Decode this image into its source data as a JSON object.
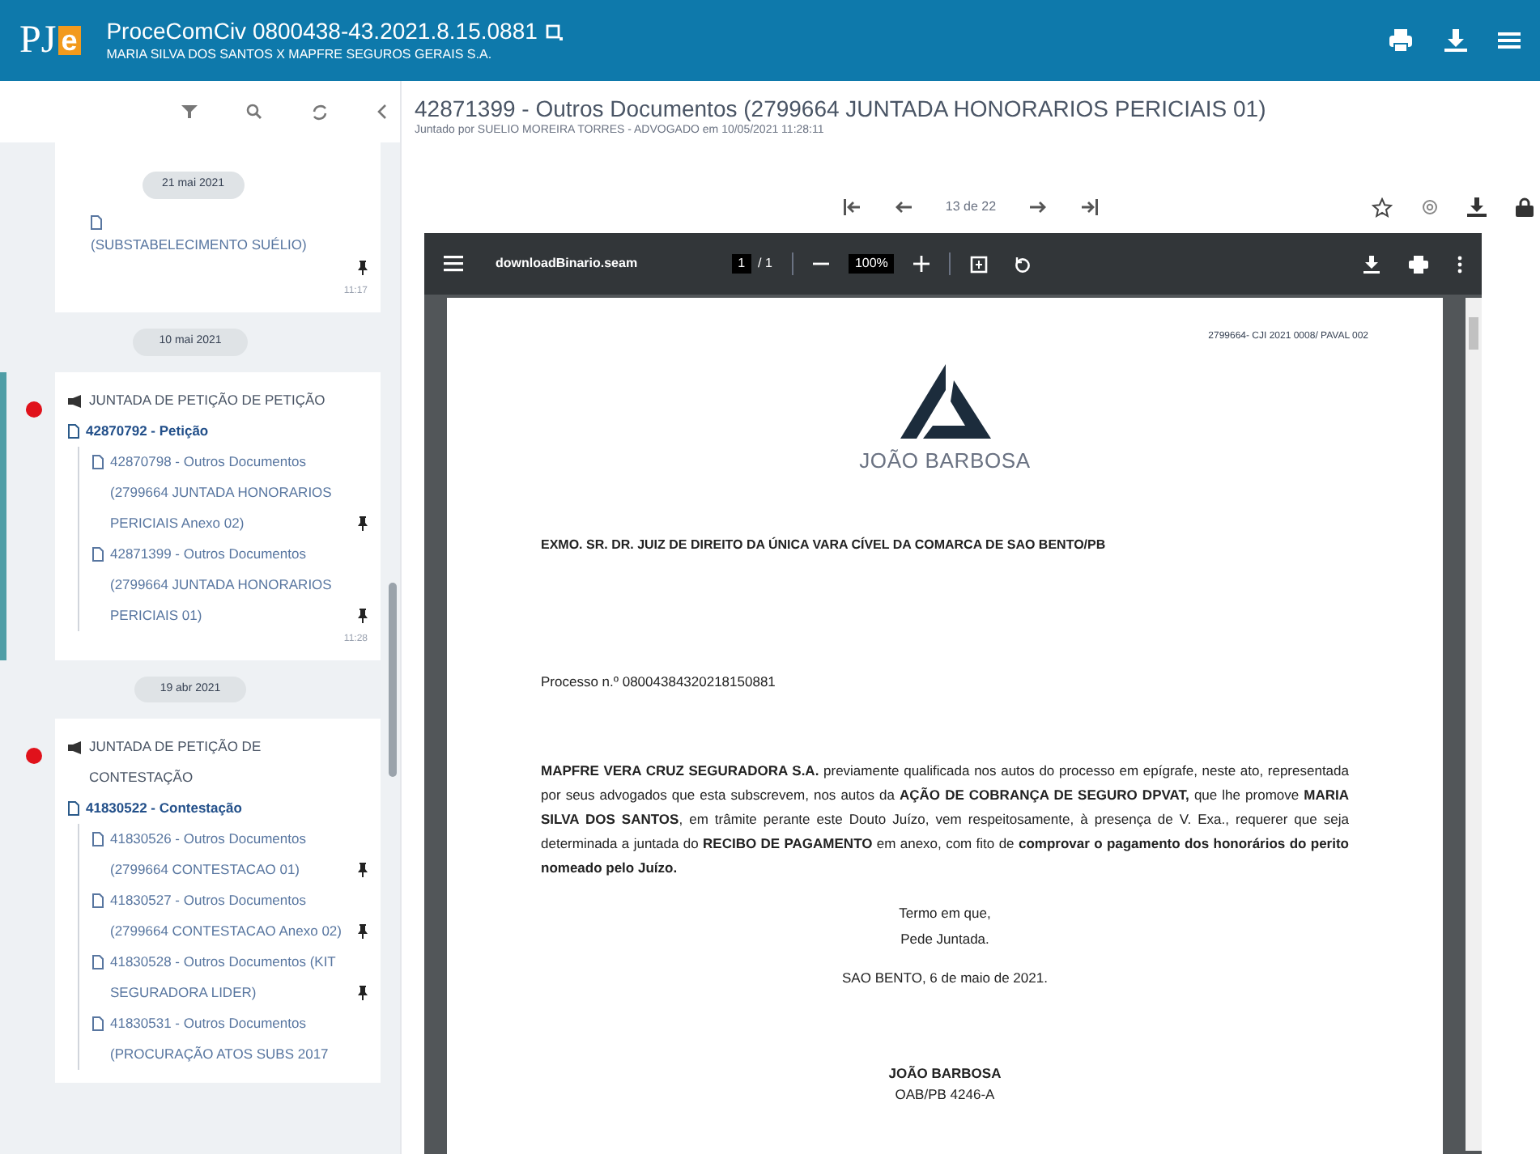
{
  "header": {
    "logo": {
      "left": "PJ",
      "right": "e"
    },
    "title": "ProceComCiv 0800438-43.2021.8.15.0881",
    "subtitle": "MARIA SILVA DOS SANTOS X MAPFRE SEGUROS GERAIS S.A."
  },
  "sidebar": {
    "sticky_date": "21 mai 2021",
    "events": [
      {
        "marked": false,
        "selected": false,
        "docs": [
          {
            "text": "(SUBSTABELECIMENTO SUÉLIO)",
            "pinned": true
          }
        ],
        "time": "11:17"
      },
      {
        "date": "10 mai 2021",
        "marked": true,
        "selected": true,
        "title": "JUNTADA DE PETIÇÃO DE PETIÇÃO",
        "main_doc": "42870792 - Petição",
        "docs": [
          {
            "text": "42870798 - Outros Documentos (2799664 JUNTADA HONORARIOS PERICIAIS Anexo 02)",
            "pinned": true
          },
          {
            "text": "42871399 - Outros Documentos (2799664 JUNTADA HONORARIOS PERICIAIS 01)",
            "pinned": true
          }
        ],
        "time": "11:28"
      },
      {
        "date": "19 abr 2021",
        "marked": true,
        "selected": false,
        "title": "JUNTADA DE PETIÇÃO DE CONTESTAÇÃO",
        "main_doc": "41830522 - Contestação",
        "docs": [
          {
            "text": "41830526 - Outros Documentos (2799664 CONTESTACAO 01)",
            "pinned": true
          },
          {
            "text": "41830527 - Outros Documentos (2799664 CONTESTACAO Anexo 02)",
            "pinned": true
          },
          {
            "text": "41830528 - Outros Documentos (KIT SEGURADORA LIDER)",
            "pinned": true
          },
          {
            "text": "41830531 - Outros Documentos (PROCURAÇÃO ATOS SUBS 2017",
            "pinned": false
          }
        ]
      }
    ]
  },
  "document": {
    "title": "42871399 - Outros Documentos (2799664 JUNTADA HONORARIOS PERICIAIS 01)",
    "subtitle": "Juntado por SUELIO MOREIRA TORRES - ADVOGADO em 10/05/2021 11:28:11",
    "position": "13 de 22"
  },
  "pdf_viewer": {
    "filename": "downloadBinario.seam",
    "page": "1",
    "pages": "/ 1",
    "zoom": "100%"
  },
  "pdf_page": {
    "reference": "2799664- CJI 2021 0008/ PAVAL 002",
    "logo_text": "JOÃO BARBOSA",
    "heading": "EXMO. SR. DR. JUIZ DE DIREITO DA ÚNICA VARA CÍVEL DA COMARCA DE SAO BENTO/PB",
    "process": "Processo n.º 08004384320218150881",
    "body": "**MAPFRE VERA CRUZ SEGURADORA S.A.** previamente qualificada nos autos do processo em epígrafe, neste ato, representada por seus advogados que esta subscrevem, nos autos da **AÇÃO DE COBRANÇA DE SEGURO DPVAT,** que lhe promove **MARIA SILVA DOS SANTOS**, em trâmite perante este Douto Juízo, vem respeitosamente, à presença de V. Exa., requerer que seja determinada a juntada do **RECIBO DE PAGAMENTO** em anexo, com fito de **comprovar o pagamento dos honorários do perito nomeado pelo Juízo.**",
    "closing": [
      "Termo em que,",
      "Pede Juntada."
    ],
    "place_date": "SAO BENTO, 6 de maio de 2021.",
    "signer": "JOÃO BARBOSA",
    "oab": "OAB/PB 4246-A"
  }
}
